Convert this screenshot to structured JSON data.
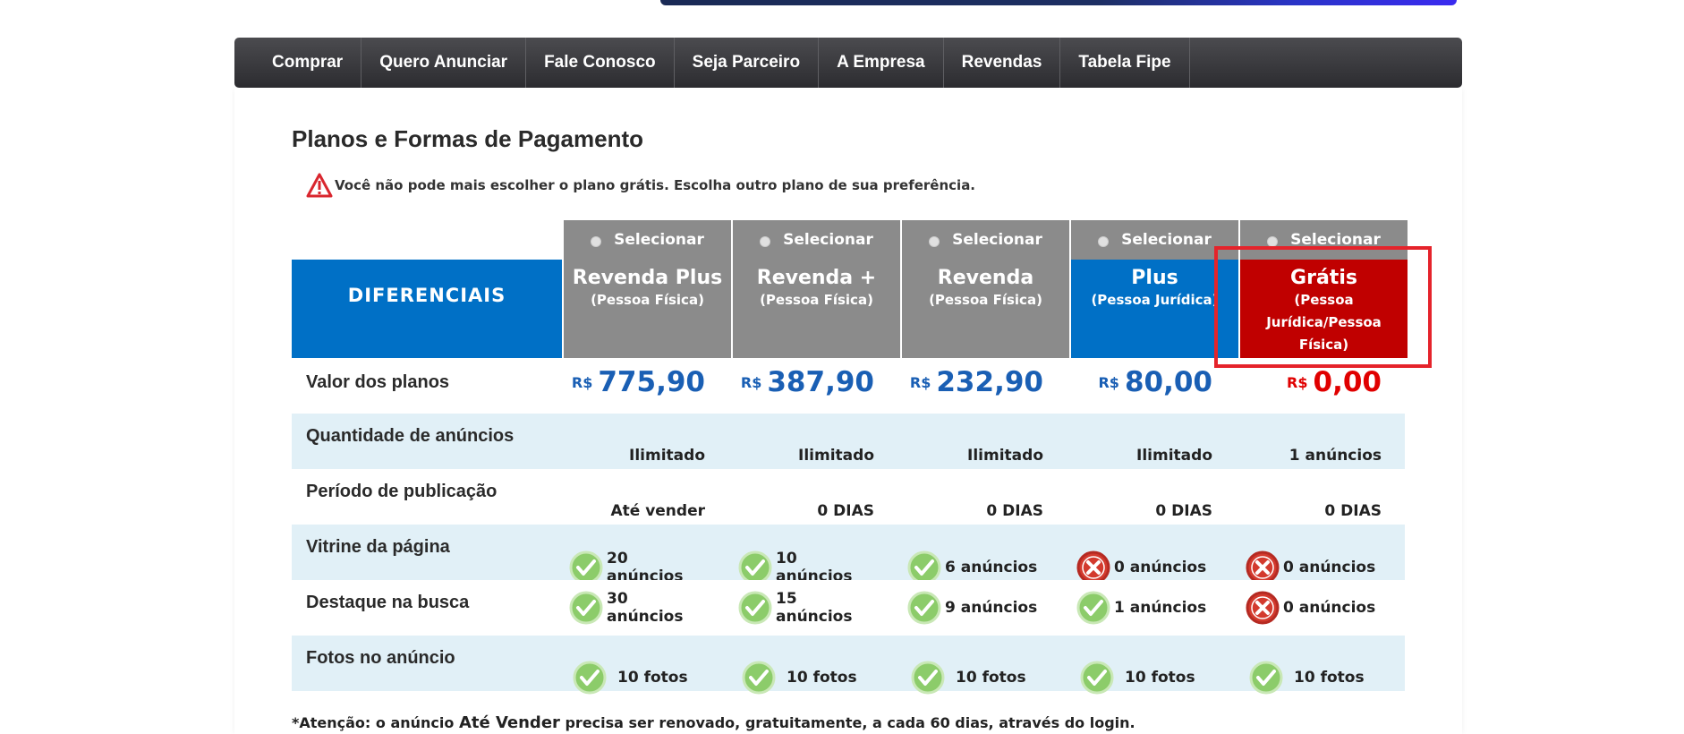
{
  "nav": [
    "Comprar",
    "Quero Anunciar",
    "Fale Conosco",
    "Seja Parceiro",
    "A Empresa",
    "Revendas",
    "Tabela Fipe"
  ],
  "page_title": "Planos e Formas de Pagamento",
  "warning": "Você não pode mais escolher o plano grátis. Escolha outro plano de sua preferência.",
  "select_label": "Selecionar",
  "diferenciais": "DIFERENCIAIS",
  "plans": [
    {
      "name": "Revenda Plus",
      "sub": "(Pessoa Física)",
      "bg": "#8b8b8b",
      "price_cur": "R$",
      "price": "775,90",
      "price_color": "#1a5fb4",
      "qtd": "Ilimitado",
      "periodo": "Até vender",
      "vitrine": "20 anúncios",
      "vitrine_ok": true,
      "destaque": "30 anúncios",
      "destaque_ok": true,
      "fotos": "10 fotos"
    },
    {
      "name": "Revenda +",
      "sub": "(Pessoa Física)",
      "bg": "#8b8b8b",
      "price_cur": "R$",
      "price": "387,90",
      "price_color": "#1a5fb4",
      "qtd": "Ilimitado",
      "periodo": "0 DIAS",
      "vitrine": "10 anúncios",
      "vitrine_ok": true,
      "destaque": "15 anúncios",
      "destaque_ok": true,
      "fotos": "10 fotos"
    },
    {
      "name": "Revenda",
      "sub": "(Pessoa Física)",
      "bg": "#8b8b8b",
      "price_cur": "R$",
      "price": "232,90",
      "price_color": "#1a5fb4",
      "qtd": "Ilimitado",
      "periodo": "0 DIAS",
      "vitrine": "6 anúncios",
      "vitrine_ok": true,
      "destaque": "9 anúncios",
      "destaque_ok": true,
      "fotos": "10 fotos"
    },
    {
      "name": "Plus",
      "sub": "(Pessoa Jurídica)",
      "bg": "#0070c6",
      "price_cur": "R$",
      "price": "80,00",
      "price_color": "#1a5fb4",
      "qtd": "Ilimitado",
      "periodo": "0 DIAS",
      "vitrine": "0 anúncios",
      "vitrine_ok": false,
      "destaque": "1 anúncios",
      "destaque_ok": true,
      "fotos": "10 fotos"
    },
    {
      "name": "Grátis",
      "sub": "(Pessoa Jurídica/Pessoa Física)",
      "bg": "#c00000",
      "price_cur": "R$",
      "price": "0,00",
      "price_color": "#e00000",
      "qtd": "1 anúncios",
      "periodo": "0 DIAS",
      "vitrine": "0 anúncios",
      "vitrine_ok": false,
      "destaque": "0 anúncios",
      "destaque_ok": false,
      "fotos": "10 fotos"
    }
  ],
  "rows": {
    "valor": "Valor dos planos",
    "qtd": "Quantidade de anúncios",
    "periodo": "Período de publicação",
    "vitrine": "Vitrine da página",
    "destaque": "Destaque na busca",
    "fotos": "Fotos no anúncio"
  },
  "footnote": {
    "pre": "*Atenção: o anúncio ",
    "strong": "Até Vender",
    "post": " precisa ser renovado, gratuitamente, a cada 60 dias, através do login."
  },
  "colors": {
    "nav_bg": "#3a3a3e",
    "diferenciais_bg": "#0070c6",
    "row_stripe": "#e1f0f7",
    "highlight": "#e5232b",
    "check": "#8ccc6a",
    "cross": "#c0392b"
  }
}
